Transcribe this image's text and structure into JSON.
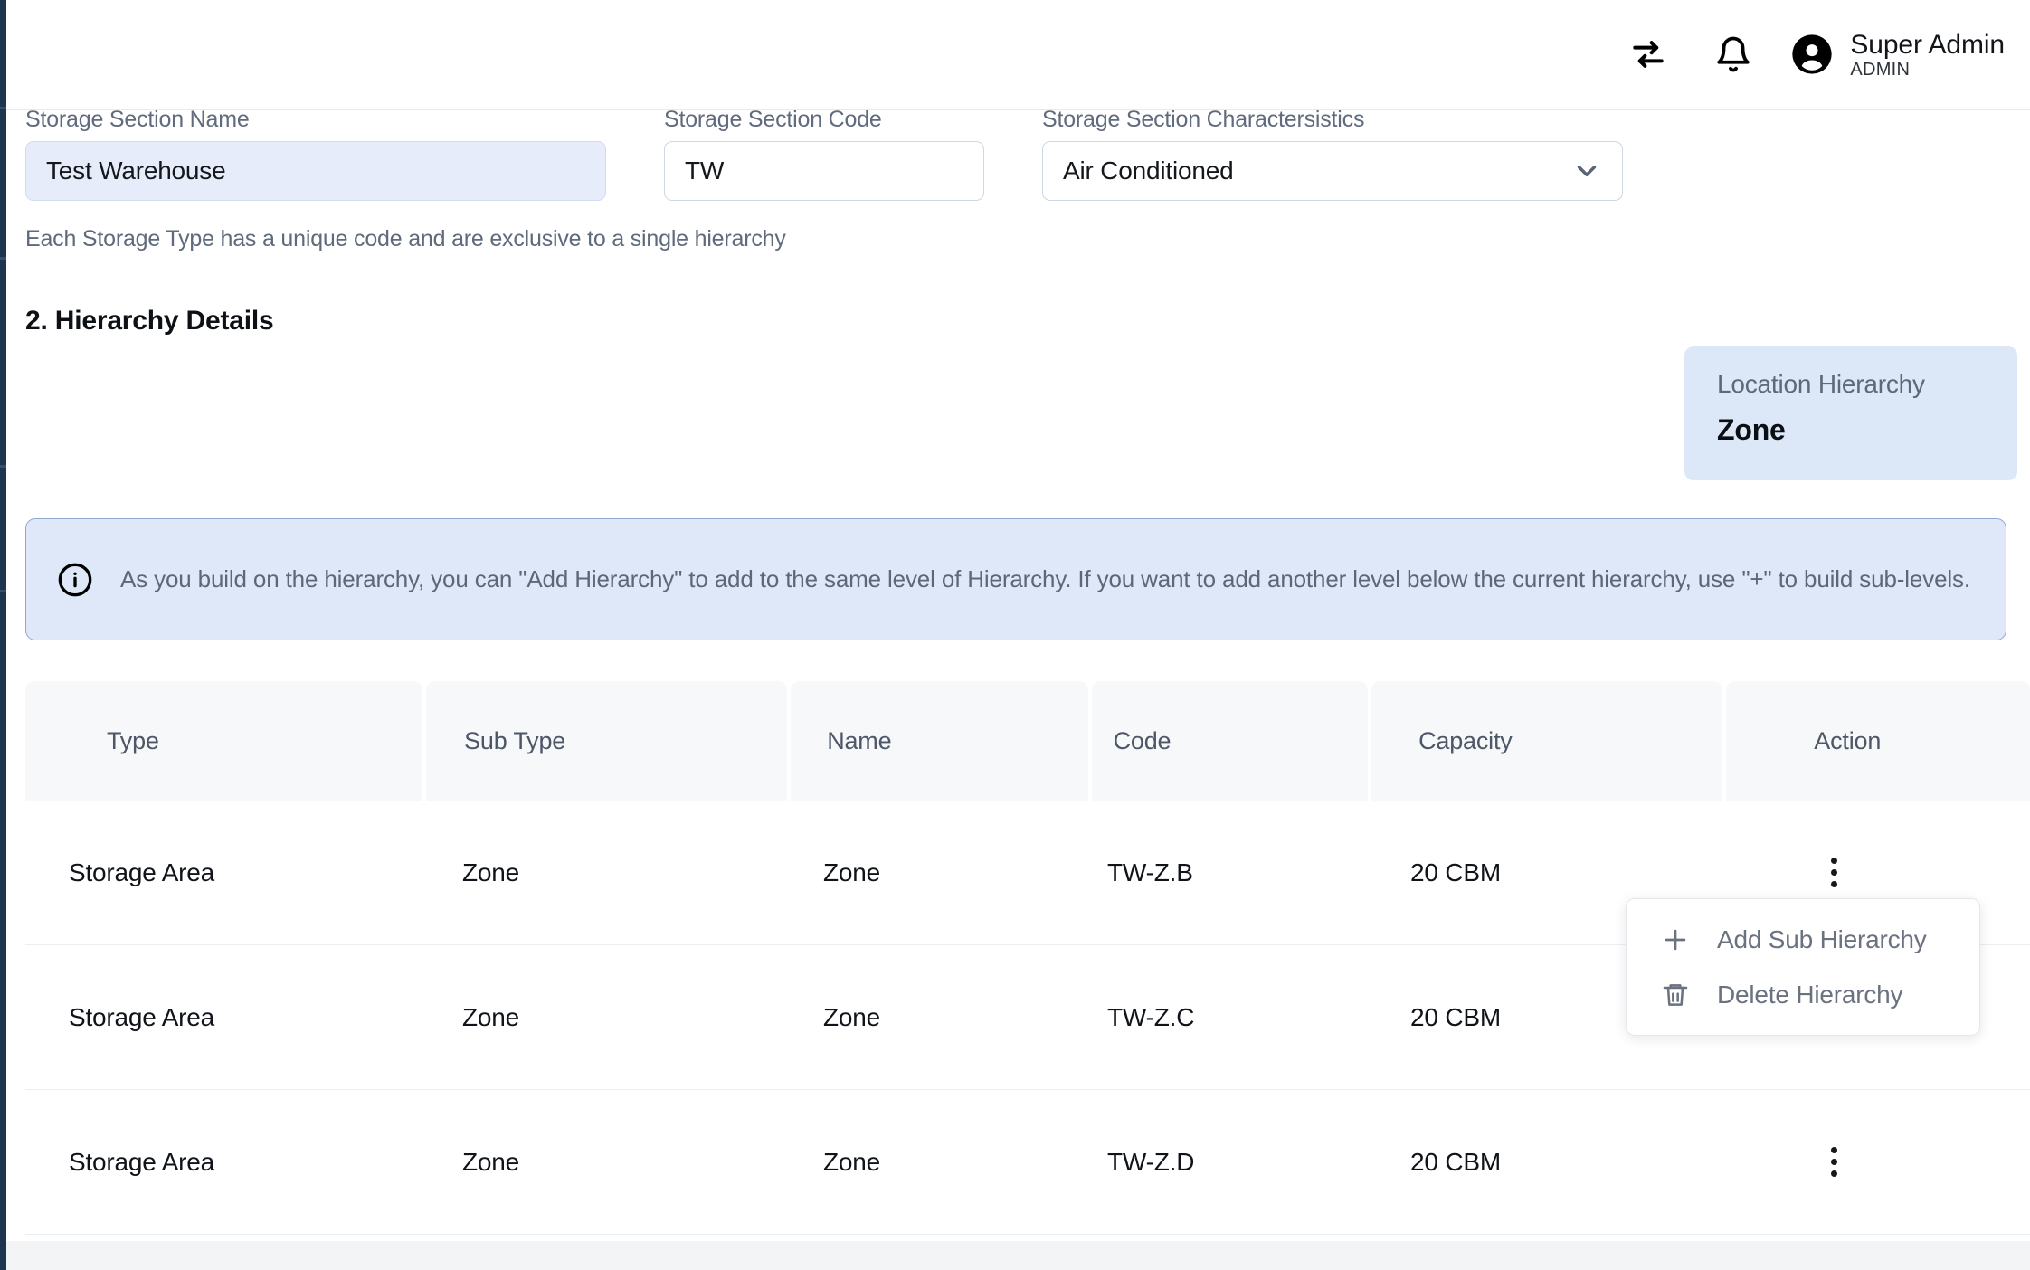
{
  "header": {
    "swap_icon": "swap-arrows-icon",
    "bell_icon": "bell-icon",
    "avatar_icon": "user-avatar-icon",
    "user_name": "Super Admin",
    "user_role": "ADMIN"
  },
  "form": {
    "fields": [
      {
        "label": "Storage Section Name",
        "value": "Test Warehouse",
        "type": "text"
      },
      {
        "label": "Storage Section Code",
        "value": "TW",
        "type": "text"
      },
      {
        "label": "Storage Section Charactersistics",
        "value": "Air Conditioned",
        "type": "select"
      }
    ],
    "helper_text": "Each Storage Type has a unique code and are exclusive to a single hierarchy"
  },
  "section": {
    "title": "2. Hierarchy Details"
  },
  "location_card": {
    "label": "Location Hierarchy",
    "value": "Zone",
    "bg_color": "#dce7f8"
  },
  "info_banner": {
    "icon": "info-circle-icon",
    "text": "As you build on the hierarchy, you can \"Add Hierarchy\" to add to the same level of Hierarchy. If you want to add another level below the current hierarchy, use \"+\" to build sub-levels.",
    "bg_color": "#dfe8f8",
    "border_color": "#8fa8cf"
  },
  "table": {
    "columns": [
      "Type",
      "Sub Type",
      "Name",
      "Code",
      "Capacity",
      "Action"
    ],
    "rows": [
      {
        "type": "Storage Area",
        "sub_type": "Zone",
        "name": "Zone",
        "code": "TW-Z.B",
        "capacity": "20 CBM"
      },
      {
        "type": "Storage Area",
        "sub_type": "Zone",
        "name": "Zone",
        "code": "TW-Z.C",
        "capacity": "20 CBM"
      },
      {
        "type": "Storage Area",
        "sub_type": "Zone",
        "name": "Zone",
        "code": "TW-Z.D",
        "capacity": "20 CBM"
      }
    ]
  },
  "action_menu": {
    "items": [
      {
        "label": "Add Sub Hierarchy",
        "icon": "plus-icon"
      },
      {
        "label": "Delete Hierarchy",
        "icon": "trash-icon"
      }
    ]
  }
}
